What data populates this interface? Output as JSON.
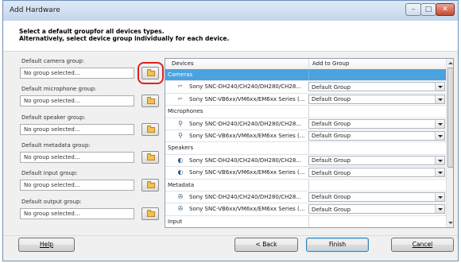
{
  "window": {
    "title": "Add Hardware",
    "buttons": {
      "minimize": "–",
      "maximize": "□",
      "close": "✕"
    }
  },
  "header": {
    "line1": "Select a default groupfor all devices types.",
    "line2": "Alternatively, select device group individually for each device."
  },
  "defaults": [
    {
      "label": "Default camera group:",
      "value": "No group selected...",
      "highlighted": true
    },
    {
      "label": "Default microphone group:",
      "value": "No group selected...",
      "highlighted": false
    },
    {
      "label": "Default speaker group:",
      "value": "No group selected...",
      "highlighted": false
    },
    {
      "label": "Default metadata group:",
      "value": "No group selected...",
      "highlighted": false
    },
    {
      "label": "Default input group:",
      "value": "No group selected...",
      "highlighted": false
    },
    {
      "label": "Default output group:",
      "value": "No group selected...",
      "highlighted": false
    }
  ],
  "grid": {
    "columns": [
      "Devices",
      "Add to Group"
    ],
    "rows": [
      {
        "type": "category",
        "label": "Cameras",
        "selected": true
      },
      {
        "type": "device",
        "icon": "camera-icon",
        "name": "Sony SNC-DH240/CH240/DH280/CH28...",
        "group": "Default Group"
      },
      {
        "type": "device",
        "icon": "camera-icon",
        "name": "Sony SNC-VB6xx/VM6xx/EM6xx Series (...",
        "group": "Default Group"
      },
      {
        "type": "category",
        "label": "Microphones",
        "selected": false
      },
      {
        "type": "device",
        "icon": "microphone-icon",
        "name": "Sony SNC-DH240/CH240/DH280/CH28...",
        "group": "Default Group"
      },
      {
        "type": "device",
        "icon": "microphone-icon",
        "name": "Sony SNC-VB6xx/VM6xx/EM6xx Series (...",
        "group": "Default Group"
      },
      {
        "type": "category",
        "label": "Speakers",
        "selected": false
      },
      {
        "type": "device",
        "icon": "speaker-icon",
        "name": "Sony SNC-DH240/CH240/DH280/CH28...",
        "group": "Default Group"
      },
      {
        "type": "device",
        "icon": "speaker-icon",
        "name": "Sony SNC-VB6xx/VM6xx/EM6xx Series (...",
        "group": "Default Group"
      },
      {
        "type": "category",
        "label": "Metadata",
        "selected": false
      },
      {
        "type": "device",
        "icon": "metadata-icon",
        "name": "Sony SNC-DH240/CH240/DH280/CH28...",
        "group": "Default Group"
      },
      {
        "type": "device",
        "icon": "metadata-icon",
        "name": "Sony SNC-VB6xx/VM6xx/EM6xx Series (...",
        "group": "Default Group"
      },
      {
        "type": "category",
        "label": "Input",
        "selected": false
      }
    ]
  },
  "footer": {
    "help": "Help",
    "back": "< Back",
    "finish": "Finish",
    "cancel": "Cancel"
  },
  "colors": {
    "selected_row": "#4aa3df",
    "highlight_ring": "#e02020"
  }
}
